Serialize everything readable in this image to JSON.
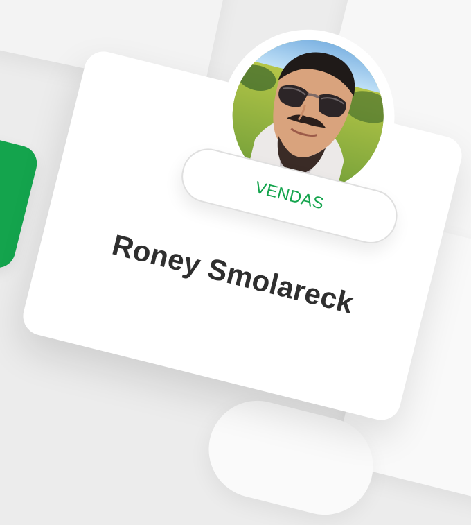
{
  "profile": {
    "department": "VENDAS",
    "name": "Roney Smolareck"
  },
  "colors": {
    "accent": "#14a44d",
    "background": "#ececec",
    "card": "#ffffff",
    "name_text": "#2f2f2f"
  },
  "icons": {
    "avatar": "profile-photo"
  }
}
